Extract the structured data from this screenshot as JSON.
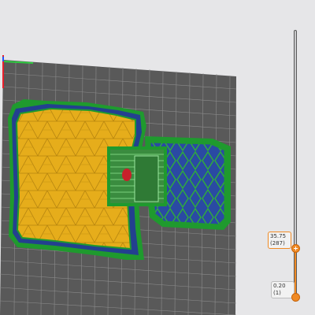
{
  "viewport": {
    "colors": {
      "background": "#e6e6e8",
      "bed": "#595959",
      "bed_grid": "#9a9a9a",
      "infill": "#e6ad1b",
      "perimeter": "#1f9a2e",
      "solid_infill": "#23408f",
      "seam": "#c8212b"
    },
    "axis_colors": {
      "x": "#2ecc40",
      "y": "#2255ff",
      "z": "#e8202b"
    }
  },
  "layer_slider": {
    "upper": {
      "height": "35.75",
      "layer": "(287)"
    },
    "lower": {
      "height": "0.20",
      "layer": "(1)"
    },
    "accent": "#f08a24"
  }
}
